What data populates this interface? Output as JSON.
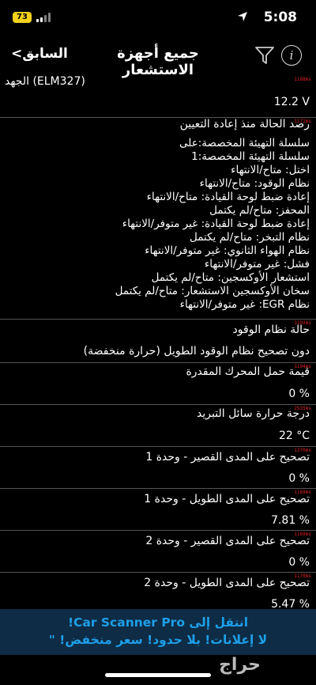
{
  "status": {
    "battery": "73",
    "time": "5:08"
  },
  "nav": {
    "back_label": "<السابق",
    "title": "جميع أجهزة الاستشعار"
  },
  "rows": {
    "voltage": {
      "label": "الجهد (ELM327)",
      "ms": "1188ms",
      "value": "12.2 V"
    },
    "monitor": {
      "label": "رصد الحالة منذ إعادة التعيين",
      "ms": "1171ms",
      "lines": [
        "سلسلة التهيئة المخصصة:على",
        "سلسلة التهيئة المخصصة:1",
        "اختل: متاح/الانتهاء",
        "نظام الوقود: متاح/الانتهاء",
        "إعادة ضبط لوحة القيادة: متاح/الانتهاء",
        "المحفز: متاح/لم يكتمل",
        "إعادة ضبط لوحة القيادة: غير متوفر/الانتهاء",
        "نظام التبخر: متاح/لم يكتمل",
        "نظام الهواء الثانوي: غير متوفر/الانتهاء",
        "فشل: غير متوفر/الانتهاء",
        "استشعار الأوكسجين: متاح/لم يكتمل",
        "سخان الأوكسجين الاستشعار: متاح/لم يكتمل",
        "نظام EGR: غير متوفر/الانتهاء"
      ]
    },
    "fuel_status": {
      "label": "حالة نظام الوقود",
      "ms": "1193ms",
      "value": "دون تصحيح نظام الوقود الطويل (حرارة منخفضة)"
    },
    "engine_load": {
      "label": "قيمة حمل المحرك المقدرة",
      "ms": "1194ms",
      "value": "0 %"
    },
    "coolant": {
      "label": "درجة حرارة سائل التبريد",
      "ms": "2535ms",
      "value": "22 °C"
    },
    "stft1": {
      "label": "تصحيح على المدى القصير - وحدة 1",
      "ms": "1370ms",
      "value": "0 %"
    },
    "ltft1": {
      "label": "تصحيح على المدى الطويل - وحدة 1",
      "ms": "1169ms",
      "value": "7.81 %"
    },
    "stft2": {
      "label": "تصحيح على المدى القصير - وحدة 2",
      "ms": "1169ms",
      "value": "0 %"
    },
    "ltft2": {
      "label": "تصحيح على المدى الطويل - وحدة 2",
      "ms": "1170ms",
      "value": "5.47 %"
    }
  },
  "banner": {
    "line1": "انتقل إلى Car Scanner Pro!",
    "line2": "لا إعلانات! بلا حدود!  سعر منخفض! \""
  },
  "watermark": "حراج",
  "colors": {
    "banner_text": "#1e9fe8",
    "banner_bg": "#0e2c45",
    "ms_text": "#e02020",
    "battery": "#f2d21b"
  }
}
